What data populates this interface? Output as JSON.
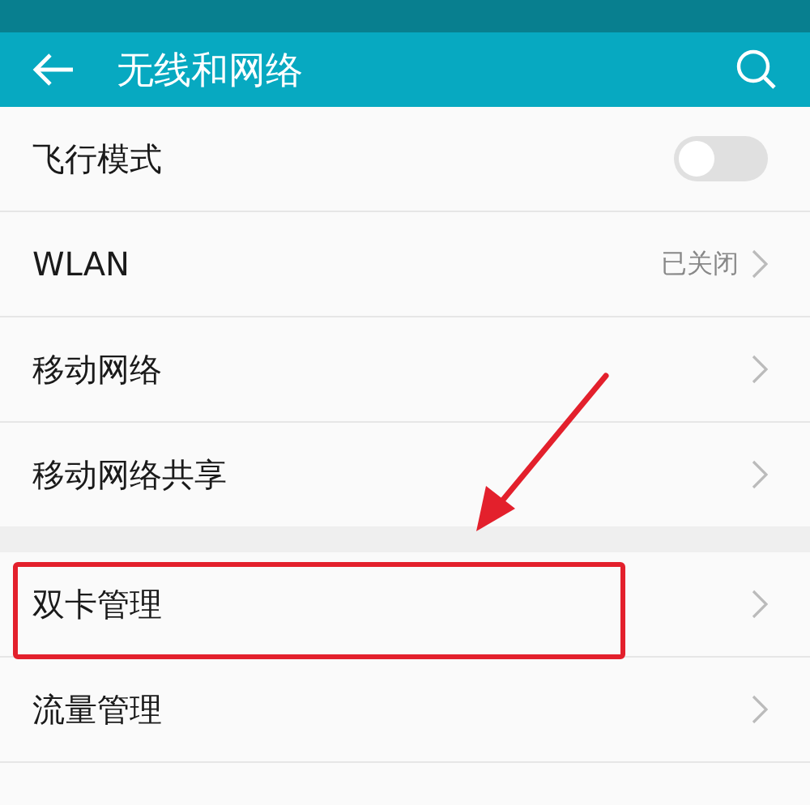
{
  "header": {
    "title": "无线和网络"
  },
  "groups": [
    {
      "items": [
        {
          "kind": "toggle",
          "label": "飞行模式",
          "on": false
        },
        {
          "kind": "link",
          "label": "WLAN",
          "value": "已关闭"
        },
        {
          "kind": "link",
          "label": "移动网络"
        },
        {
          "kind": "link",
          "label": "移动网络共享"
        }
      ]
    },
    {
      "items": [
        {
          "kind": "link",
          "label": "双卡管理",
          "highlighted": true
        },
        {
          "kind": "link",
          "label": "流量管理"
        }
      ]
    }
  ]
}
